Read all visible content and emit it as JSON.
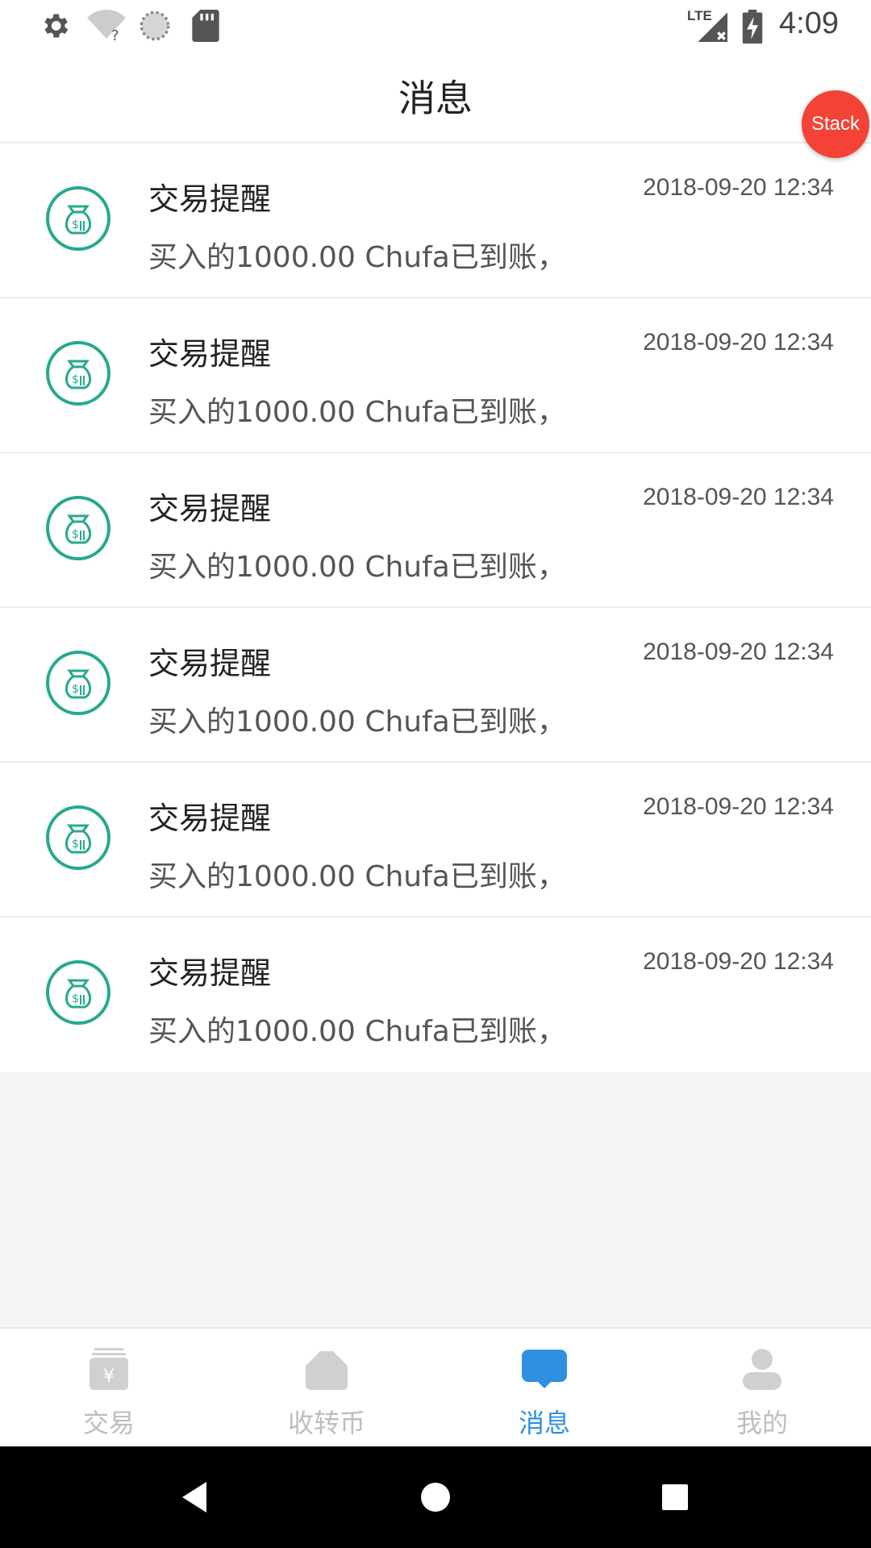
{
  "status_bar": {
    "time": "4:09",
    "network": "LTE",
    "icons": [
      "settings-icon",
      "wifi-unknown-icon",
      "sync-icon",
      "sd-card-icon",
      "signal-icon",
      "battery-charging-icon"
    ]
  },
  "header": {
    "title": "消息"
  },
  "stack_button": {
    "label": "Stack"
  },
  "messages": [
    {
      "title": "交易提醒",
      "time": "2018-09-20 12:34",
      "body": "买入的1000.00 Chufa已到账，"
    },
    {
      "title": "交易提醒",
      "time": "2018-09-20 12:34",
      "body": "买入的1000.00 Chufa已到账，"
    },
    {
      "title": "交易提醒",
      "time": "2018-09-20 12:34",
      "body": "买入的1000.00 Chufa已到账，"
    },
    {
      "title": "交易提醒",
      "time": "2018-09-20 12:34",
      "body": "买入的1000.00 Chufa已到账，"
    },
    {
      "title": "交易提醒",
      "time": "2018-09-20 12:34",
      "body": "买入的1000.00 Chufa已到账，"
    },
    {
      "title": "交易提醒",
      "time": "2018-09-20 12:34",
      "body": "买入的1000.00 Chufa已到账，"
    }
  ],
  "tabs": [
    {
      "label": "交易",
      "icon": "trade-icon",
      "active": false
    },
    {
      "label": "收转币",
      "icon": "wallet-icon",
      "active": false
    },
    {
      "label": "消息",
      "icon": "message-icon",
      "active": true
    },
    {
      "label": "我的",
      "icon": "profile-icon",
      "active": false
    }
  ],
  "colors": {
    "accent": "#2f8fe0",
    "icon_teal": "#26a98f",
    "stack_red": "#f44336",
    "inactive": "#bdbdbd"
  }
}
